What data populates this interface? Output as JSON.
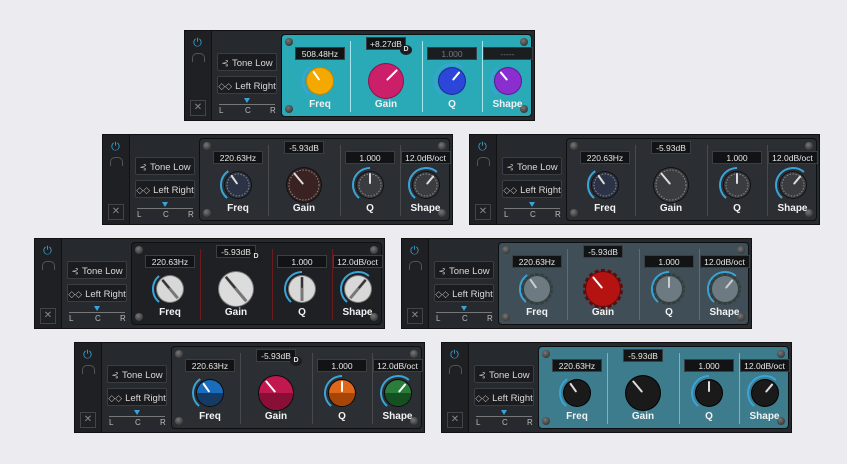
{
  "sidebar": {
    "tone_label": "Tone Low",
    "stereo_label": "Left Right",
    "pan_l": "L",
    "pan_c": "C",
    "pan_r": "R",
    "close_icon": "close-icon",
    "power_icon": "power-icon"
  },
  "labels": {
    "freq": "Freq",
    "gain": "Gain",
    "q": "Q",
    "shape": "Shape",
    "d_badge": "D"
  },
  "variants": [
    {
      "freq": "508.48Hz",
      "gain": "+8.27dB",
      "q": "1.000",
      "shape": "-----",
      "style": "colorful-teal"
    },
    {
      "freq": "220.63Hz",
      "gain": "-5.93dB",
      "q": "1.000",
      "shape": "12.0dB/oct",
      "style": "dark-fluted"
    },
    {
      "freq": "220.63Hz",
      "gain": "-5.93dB",
      "q": "1.000",
      "shape": "12.0dB/oct",
      "style": "dark-fluted-alt"
    },
    {
      "freq": "220.63Hz",
      "gain": "-5.93dB",
      "q": "1.000",
      "shape": "12.0dB/oct",
      "style": "silver-stripe"
    },
    {
      "freq": "220.63Hz",
      "gain": "-5.93dB",
      "q": "1.000",
      "shape": "12.0dB/oct",
      "style": "grey-red"
    },
    {
      "freq": "220.63Hz",
      "gain": "-5.93dB",
      "q": "1.000",
      "shape": "12.0dB/oct",
      "style": "two-tone"
    },
    {
      "freq": "220.63Hz",
      "gain": "-5.93dB",
      "q": "1.000",
      "shape": "12.0dB/oct",
      "style": "black-teal"
    }
  ],
  "colors": {
    "accent": "#3aa4d8",
    "teal_panel": "#2aa9b7",
    "dark_panel": "#2b2e32"
  }
}
